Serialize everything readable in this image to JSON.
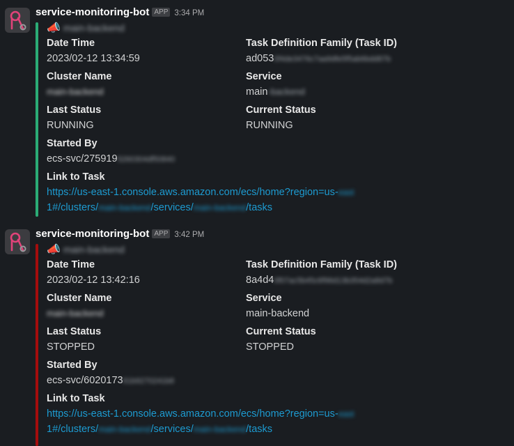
{
  "messages": [
    {
      "bot_name": "service-monitoring-bot",
      "app_badge": "APP",
      "time": "3:34 PM",
      "bar_color": "#2bac76",
      "megaphone": "📣",
      "subtitle": "main-backend",
      "fields": {
        "date_time_label": "Date Time",
        "date_time_value": "2023/02-12 13:34:59",
        "task_def_label": "Task Definition Family (Task ID)",
        "task_def_value": "ad053",
        "task_def_hidden": "0f4de3476c7aa9dfe5f5ab6bdd87b",
        "cluster_label": "Cluster Name",
        "cluster_hidden": "main-backend",
        "service_label": "Service",
        "service_value": "main",
        "service_hidden": "-backend",
        "last_status_label": "Last Status",
        "last_status_value": "RUNNING",
        "current_status_label": "Current Status",
        "current_status_value": "RUNNING",
        "started_by_label": "Started By",
        "started_by_value": "ecs-svc/275919",
        "started_by_hidden": "5260304df50840",
        "link_label": "Link to Task",
        "link_part1": "https://us-east-1.console.aws.amazon.com/ecs/home?region=us-",
        "link_hidden1": "east",
        "link_part2": "1#/clusters/",
        "link_hidden2": "main-backend",
        "link_part3": "/services/",
        "link_hidden3": "main-backend",
        "link_part4": "/tasks"
      }
    },
    {
      "bot_name": "service-monitoring-bot",
      "app_badge": "APP",
      "time": "3:42 PM",
      "bar_color": "#a50d0d",
      "megaphone": "📣",
      "subtitle": "main-backend",
      "fields": {
        "date_time_label": "Date Time",
        "date_time_value": "2023/02-12 13:42:16",
        "task_def_label": "Task Definition Family (Task ID)",
        "task_def_value": "8a4d4",
        "task_def_hidden": "0f07ac5b45c6f96d13b354d2a8d7b",
        "cluster_label": "Cluster Name",
        "cluster_hidden": "main-backend",
        "service_label": "Service",
        "service_value": "main-backend",
        "service_hidden": "",
        "last_status_label": "Last Status",
        "last_status_value": "STOPPED",
        "current_status_label": "Current Status",
        "current_status_value": "STOPPED",
        "started_by_label": "Started By",
        "started_by_value": "ecs-svc/6020173",
        "started_by_hidden": "61b9270241b8",
        "link_label": "Link to Task",
        "link_part1": "https://us-east-1.console.aws.amazon.com/ecs/home?region=us-",
        "link_hidden1": "east",
        "link_part2": "1#/clusters/",
        "link_hidden2": "main-backend",
        "link_part3": "/services/",
        "link_hidden3": "main-backend",
        "link_part4": "/tasks"
      }
    }
  ]
}
